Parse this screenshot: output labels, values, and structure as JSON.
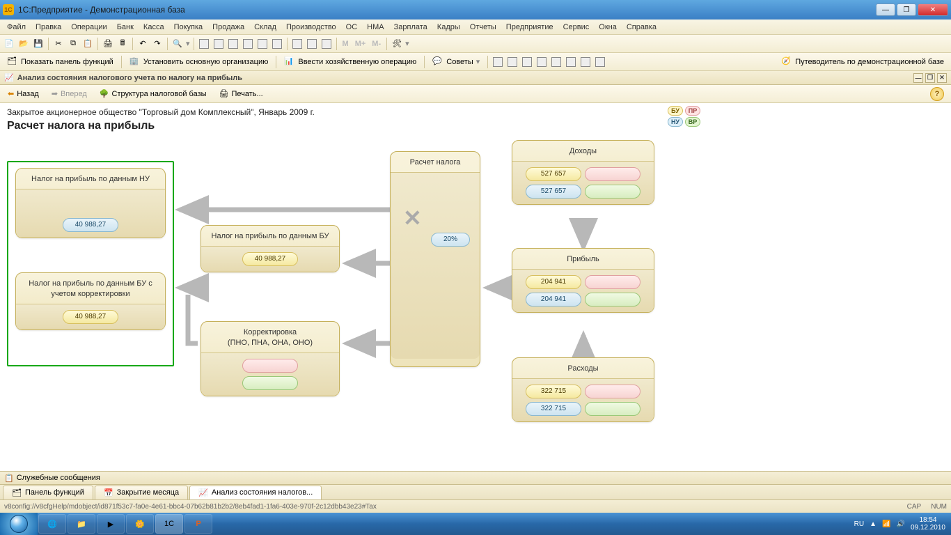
{
  "window": {
    "title": "1С:Предприятие - Демонстрационная база"
  },
  "menu": [
    "Файл",
    "Правка",
    "Операции",
    "Банк",
    "Касса",
    "Покупка",
    "Продажа",
    "Склад",
    "Производство",
    "ОС",
    "НМА",
    "Зарплата",
    "Кадры",
    "Отчеты",
    "Предприятие",
    "Сервис",
    "Окна",
    "Справка"
  ],
  "toolbar2": {
    "show_panel": "Показать панель функций",
    "set_org": "Установить основную организацию",
    "enter_op": "Ввести хозяйственную операцию",
    "advice": "Советы",
    "guide": "Путеводитель по демонстрационной базе"
  },
  "tab_header": "Анализ состояния налогового учета по налогу на прибыль",
  "subtoolbar": {
    "back": "Назад",
    "forward": "Вперед",
    "structure": "Структура налоговой базы",
    "print": "Печать..."
  },
  "page": {
    "org": "Закрытое акционерное общество \"Торговый дом Комплексный\", Январь 2009 г.",
    "title": "Расчет налога на прибыль"
  },
  "legend": {
    "bu": "БУ",
    "pr": "ПР",
    "nu": "НУ",
    "vr": "ВР"
  },
  "cards": {
    "nu": {
      "title": "Налог на прибыль по данным НУ",
      "value": "40 988,27"
    },
    "bu_corr": {
      "title": "Налог на прибыль по данным БУ с учетом корректировки",
      "value": "40 988,27"
    },
    "bu": {
      "title": "Налог на прибыль по данным БУ",
      "value": "40 988,27"
    },
    "corr": {
      "title": "Корректировка",
      "subtitle": "(ПНО, ПНА, ОНА, ОНО)"
    },
    "calc": {
      "title": "Расчет налога",
      "rate": "20%"
    },
    "income": {
      "title": "Доходы",
      "yellow": "527 657",
      "blue": "527 657"
    },
    "profit": {
      "title": "Прибыль",
      "yellow": "204 941",
      "blue": "204 941"
    },
    "expense": {
      "title": "Расходы",
      "yellow": "322 715",
      "blue": "322 715"
    }
  },
  "svc": "Служебные сообщения",
  "tabs": [
    {
      "label": "Панель функций"
    },
    {
      "label": "Закрытие месяца"
    },
    {
      "label": "Анализ состояния налогов...",
      "active": true
    }
  ],
  "status": {
    "path": "v8config://v8cfgHelp/mdobject/id871f53c7-fa0e-4e61-bbc4-07b62b81b2b2/8eb4fad1-1fa6-403e-970f-2c12dbb43e23#Tax",
    "cap": "CAP",
    "num": "NUM"
  },
  "tray": {
    "lang": "RU",
    "time": "18:54",
    "date": "09.12.2010"
  }
}
